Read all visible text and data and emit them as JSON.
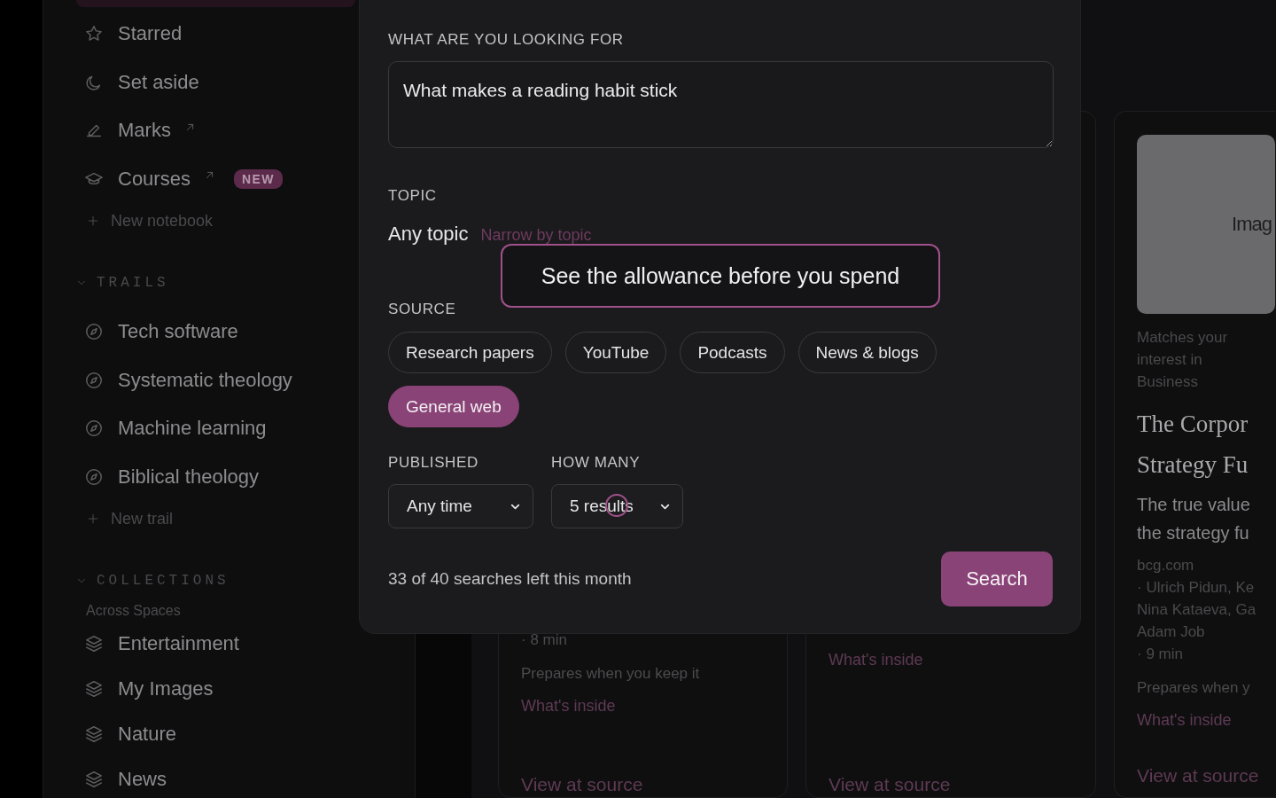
{
  "sidebar": {
    "active_item_cut": true,
    "nav_items": [
      {
        "kind": "star",
        "label": "Starred",
        "external": false
      },
      {
        "kind": "moon",
        "label": "Set aside",
        "external": false
      },
      {
        "kind": "pen",
        "label": "Marks",
        "external": true
      },
      {
        "kind": "cap",
        "label": "Courses",
        "external": true,
        "badge": "NEW"
      }
    ],
    "new_notebook": "New notebook",
    "sections": [
      {
        "kind": "trails",
        "title": "TRAILS",
        "expanded": true,
        "items": [
          "Tech software",
          "Systematic theology",
          "Machine learning",
          "Biblical theology"
        ],
        "add_label": "New trail"
      },
      {
        "kind": "collections",
        "title": "COLLECTIONS",
        "expanded": true,
        "subtitle": "Across Spaces",
        "items": [
          "Entertainment",
          "My Images",
          "Nature",
          "News"
        ]
      }
    ]
  },
  "cards": [
    {
      "time": "· 8 min",
      "prepares": "Prepares when you keep it",
      "whats_inside": "What's inside",
      "view": "View at source"
    },
    {
      "whats_inside": "What's inside",
      "view": "View at source"
    },
    {
      "image_label": "Imag",
      "match": "Matches your interest in Business",
      "title_lines": [
        "The Corpor",
        "Strategy Fu"
      ],
      "desc_lines": [
        "The true value",
        "the strategy fu"
      ],
      "source": "bcg.com",
      "author_lines": [
        "· Ulrich Pidun, Ke",
        "Nina Kataeva, Ga",
        "Adam Job"
      ],
      "time": "· 9 min",
      "prepares": "Prepares when y",
      "whats_inside": "What's inside",
      "view": "View at source"
    }
  ],
  "search_panel": {
    "query_label": "WHAT ARE YOU LOOKING FOR",
    "query": "What makes a reading habit stick",
    "topic_label": "TOPIC",
    "topic_value": "Any topic",
    "topic_link": "Narrow by topic",
    "tooltip": "See the allowance before you spend",
    "source_label": "SOURCE",
    "sources": [
      {
        "label": "Research papers",
        "selected": false
      },
      {
        "label": "YouTube",
        "selected": false
      },
      {
        "label": "Podcasts",
        "selected": false
      },
      {
        "label": "News & blogs",
        "selected": false
      },
      {
        "label": "General web",
        "selected": true
      }
    ],
    "published": {
      "label": "PUBLISHED",
      "value": "Any time"
    },
    "how_many": {
      "label": "HOW MANY",
      "value": "5 results"
    },
    "quota": "33 of 40 searches left this month",
    "search_button": "Search"
  }
}
